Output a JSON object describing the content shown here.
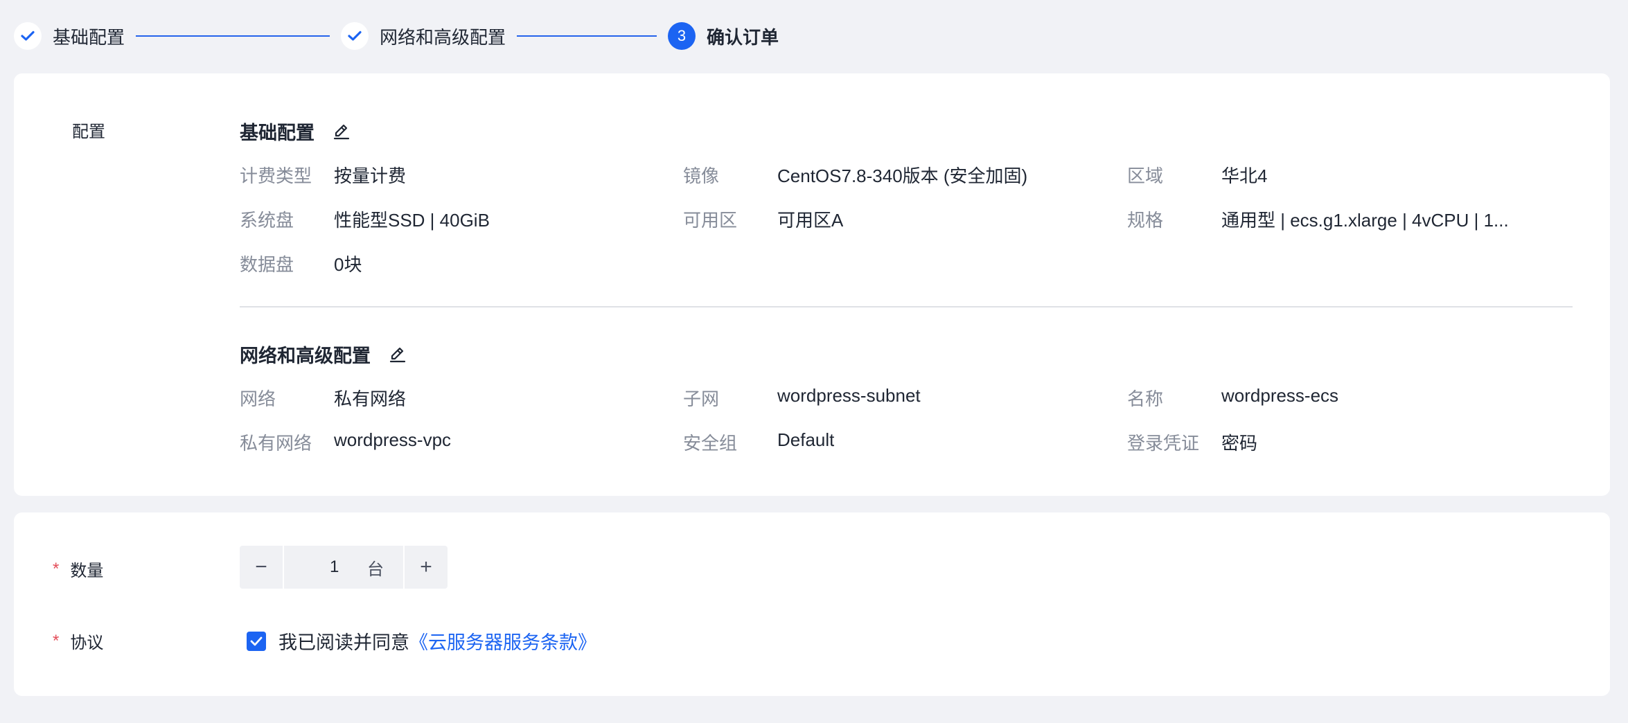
{
  "steps": [
    {
      "label": "基础配置",
      "status": "done"
    },
    {
      "label": "网络和高级配置",
      "status": "done"
    },
    {
      "label": "确认订单",
      "status": "active",
      "number": "3"
    }
  ],
  "config": {
    "side_label": "配置",
    "basic": {
      "title": "基础配置",
      "rows": [
        {
          "key": "计费类型",
          "value": "按量计费"
        },
        {
          "key": "镜像",
          "value": "CentOS7.8-340版本 (安全加固)"
        },
        {
          "key": "区域",
          "value": "华北4"
        },
        {
          "key": "系统盘",
          "value": "性能型SSD | 40GiB"
        },
        {
          "key": "可用区",
          "value": "可用区A"
        },
        {
          "key": "规格",
          "value": "通用型 | ecs.g1.xlarge | 4vCPU | 1..."
        },
        {
          "key": "数据盘",
          "value": "0块"
        }
      ]
    },
    "network": {
      "title": "网络和高级配置",
      "rows": [
        {
          "key": "网络",
          "value": "私有网络"
        },
        {
          "key": "子网",
          "value": "wordpress-subnet"
        },
        {
          "key": "名称",
          "value": "wordpress-ecs"
        },
        {
          "key": "私有网络",
          "value": "wordpress-vpc"
        },
        {
          "key": "安全组",
          "value": "Default"
        },
        {
          "key": "登录凭证",
          "value": "密码"
        }
      ]
    }
  },
  "order": {
    "quantity_label": "数量",
    "quantity_value": "1",
    "quantity_unit": "台",
    "minus_symbol": "−",
    "plus_symbol": "+",
    "agreement_label": "协议",
    "agreement_text": "我已阅读并同意",
    "agreement_link": "《云服务器服务条款》",
    "agreement_checked": true,
    "required_mark": "*"
  },
  "colors": {
    "primary": "#1c64f2",
    "required": "#e34d59",
    "background": "#f1f2f6"
  }
}
